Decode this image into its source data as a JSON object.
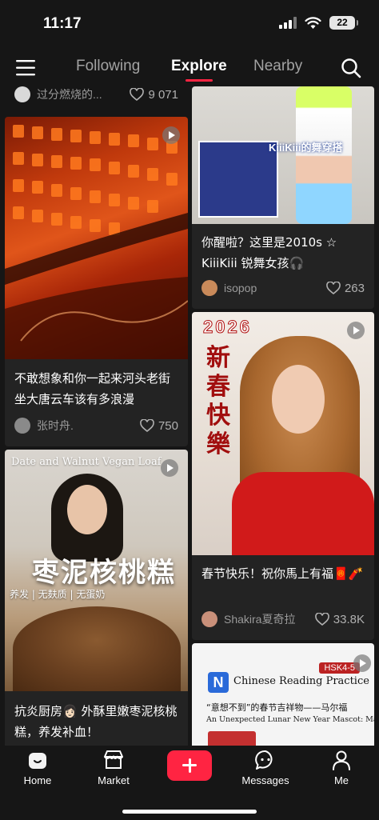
{
  "status": {
    "time": "11:17",
    "battery": "22"
  },
  "nav": {
    "tabs": [
      {
        "label": "Following"
      },
      {
        "label": "Explore"
      },
      {
        "label": "Nearby"
      }
    ],
    "active_tab": "Explore"
  },
  "feed": {
    "left": [
      {
        "author": "过分燃烧的...",
        "likes": "9 071"
      },
      {
        "title": "不敢想象和你一起来河头老街坐大唐云车该有多浪漫",
        "author": "张时舟.",
        "likes": "750"
      },
      {
        "overlay_title": "Date and Walnut Vegan Loaf",
        "overlay_big": "枣泥核桃糕",
        "overlay_tags": "养发 | 无麸质 | 无蛋奶",
        "title": "抗炎厨房👩🏻 外酥里嫩枣泥核桃糕，养发补血！"
      }
    ],
    "right": [
      {
        "overlay_text": "KiiiKiii的舞穿搭",
        "title": "你醒啦？这里是2010s ☆ KiiiKiii 锐舞女孩🎧",
        "author": "isopop",
        "likes": "263"
      },
      {
        "overlay_year": "2026",
        "overlay_big": "新春快樂",
        "title": "春节快乐！祝你馬上有福🧧🧨",
        "author": "Shakira夏奇拉",
        "likes": "33.8K"
      },
      {
        "overlay_tag": "HSK4-5",
        "overlay_title": "Chinese Reading Practice",
        "overlay_sub_cn": "“意想不到”的春节吉祥物——马尔福",
        "overlay_sub_en": "An Unexpected Lunar New Year Mascot: Malfoy"
      }
    ]
  },
  "bottom_nav": {
    "items": [
      {
        "label": "Home"
      },
      {
        "label": "Market"
      },
      {
        "label": "Messages"
      },
      {
        "label": "Me"
      }
    ]
  },
  "colors": {
    "accent": "#ff2442",
    "background": "#161616",
    "card": "#232323"
  }
}
